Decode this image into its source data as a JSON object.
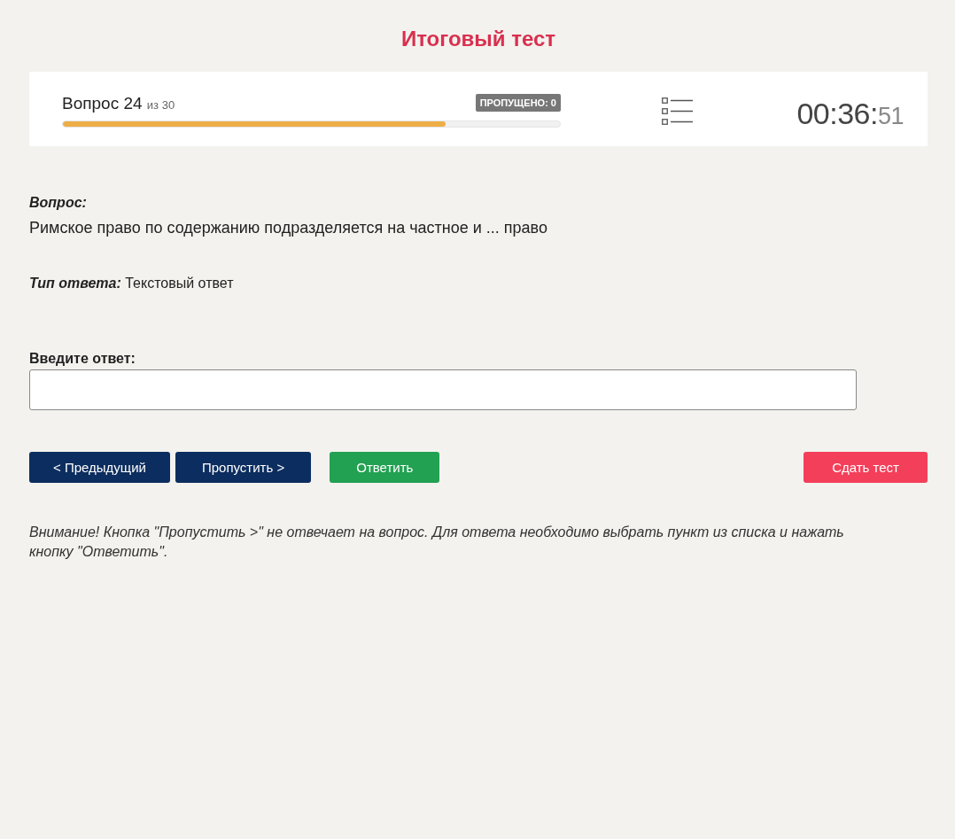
{
  "title": "Итоговый тест",
  "progress": {
    "question": "Вопрос 24",
    "total": "из 30",
    "skipped_badge": "ПРОПУЩЕНО: 0",
    "level": 0.77
  },
  "timer": {
    "time": "00:36:",
    "seconds": "51"
  },
  "question": {
    "label": "Вопрос:",
    "text": "Римское право по содержанию подразделяется на частное и ... право"
  },
  "answer_type": {
    "label": "Тип ответа:",
    "value": "Текстовый ответ"
  },
  "answer": {
    "label": "Введите ответ:"
  },
  "buttons": [
    {
      "label": "< Предыдущий",
      "kind": "nav"
    },
    {
      "label": "Пропустить >",
      "kind": "nav"
    },
    {
      "label": "Ответить",
      "kind": "submit"
    },
    {
      "label": "Сдать тест",
      "kind": "finish"
    }
  ],
  "notice": "Внимание! Кнопка \"Пропустить >\" не отвечает на вопрос. Для ответа необходимо выбрать пункт из списка и нажать кнопку \"Ответить\"."
}
